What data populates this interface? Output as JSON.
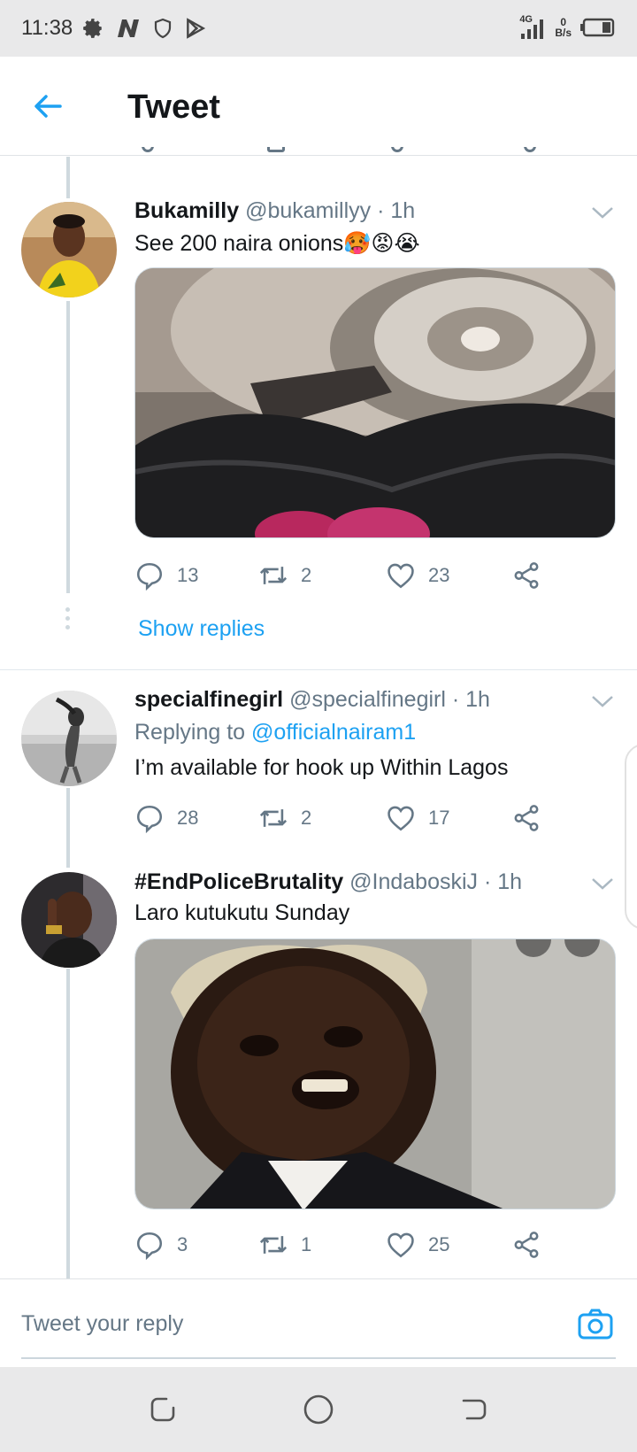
{
  "status_bar": {
    "time": "11:38",
    "network": "4G",
    "speed_value": "0",
    "speed_unit": "B/s"
  },
  "header": {
    "title": "Tweet"
  },
  "colors": {
    "accent": "#1da1f2",
    "muted": "#657786",
    "text": "#14171a"
  },
  "tweets": [
    {
      "name": "Bukamilly",
      "handle": "@bukamillyy",
      "time": "· 1h",
      "text": "See 200 naira onions🥵😡😭",
      "media": "photo of onions in black bag beside stove burner",
      "replies": "13",
      "retweets": "2",
      "likes": "23"
    },
    {
      "name": "specialfinegirl",
      "handle": "@specialfinegirl",
      "time": "· 1h",
      "replying_label": "Replying to",
      "replying_mention": "@officialnairam1",
      "text": "I’m available for hook up Within Lagos",
      "replies": "28",
      "retweets": "2",
      "likes": "17"
    },
    {
      "name": "#EndPoliceBrutality",
      "handle": "@IndaboskiJ",
      "time": "· 1h",
      "text": "Laro kutukutu Sunday",
      "media": "photo of smiling man wearing lawyer wig",
      "replies": "3",
      "retweets": "1",
      "likes": "25"
    }
  ],
  "show_replies": "Show replies",
  "reply_bar": {
    "placeholder": "Tweet your reply"
  },
  "icons": {
    "back": "arrow-left-icon",
    "reply": "speech-bubble-icon",
    "retweet": "retweet-icon",
    "like": "heart-icon",
    "share": "share-icon",
    "caret": "chevron-down-icon",
    "camera": "camera-icon"
  }
}
